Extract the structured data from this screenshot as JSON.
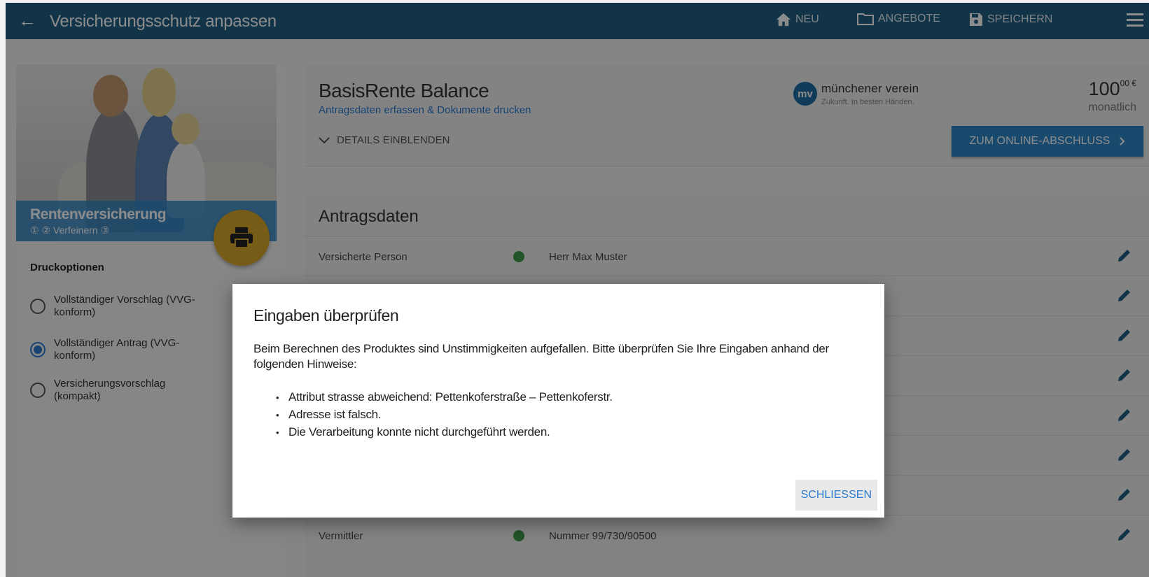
{
  "header": {
    "title": "Versicherungsschutz anpassen",
    "new_label": "NEU",
    "offers_label": "ANGEBOTE",
    "save_label": "SPEICHERN"
  },
  "left": {
    "hero_title": "Rentenversicherung",
    "hero_steps": "① ② Verfeinern ③",
    "print_options_label": "Druckoptionen",
    "options": [
      {
        "label": "Vollständiger Vorschlag (VVG-konform)",
        "selected": false
      },
      {
        "label": "Vollständiger Antrag (VVG-konform)",
        "selected": true
      },
      {
        "label": "Versicherungsvorschlag (kompakt)",
        "selected": false
      }
    ]
  },
  "product": {
    "title": "BasisRente Balance",
    "subtitle": "Antragsdaten erfassen & Dokumente drucken",
    "details_toggle": "DETAILS EINBLENDEN",
    "insurer_logo_text": "mv",
    "insurer_name": "münchener verein",
    "insurer_slogan": "Zukunft. In besten Händen.",
    "price_main": "100",
    "price_cents": "00 €",
    "price_period": "monatlich",
    "cta_label": "ZUM ONLINE-ABSCHLUSS"
  },
  "antragsdaten": {
    "title": "Antragsdaten",
    "rows": [
      {
        "label": "Versicherte Person",
        "value": "Herr Max Muster"
      },
      {
        "label": "",
        "value": ""
      },
      {
        "label": "",
        "value": ""
      },
      {
        "label": "",
        "value": ""
      },
      {
        "label": "",
        "value": ""
      },
      {
        "label": "",
        "value": ""
      },
      {
        "label": "",
        "value": ""
      },
      {
        "label": "Vermittler",
        "value": "Nummer 99/730/90500"
      }
    ]
  },
  "dialog": {
    "title": "Eingaben überprüfen",
    "message": "Beim Berechnen des Produktes sind Unstimmigkeiten aufgefallen. Bitte überprüfen Sie Ihre Eingaben anhand der folgenden Hinweise:",
    "items": [
      "Attribut strasse abweichend: Pettenkoferstraße – Pettenkoferstr.",
      "Adresse ist falsch.",
      "Die Verarbeitung konnte nicht durchgeführt werden."
    ],
    "close_label": "SCHLIEßEN"
  },
  "colors": {
    "header": "#205f86",
    "accent": "#2a7bd0",
    "print_fab": "#d9a82b",
    "status_ok": "#3c9a45"
  }
}
